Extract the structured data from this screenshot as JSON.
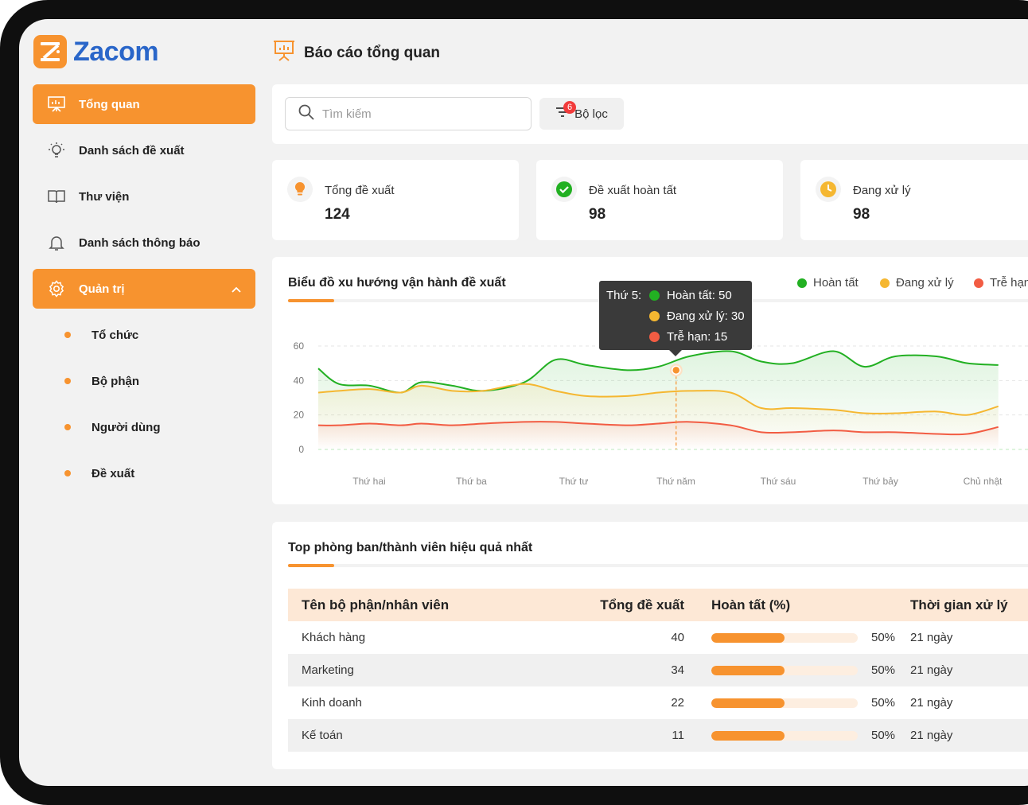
{
  "brand": {
    "name": "Zacom"
  },
  "sidebar": {
    "items": [
      {
        "label": "Tổng quan",
        "icon": "presentation-icon"
      },
      {
        "label": "Danh sách đề xuất",
        "icon": "lightbulb-icon"
      },
      {
        "label": "Thư viện",
        "icon": "book-icon"
      },
      {
        "label": "Danh sách thông báo",
        "icon": "bell-icon"
      }
    ],
    "group": {
      "label": "Quản trị",
      "icon": "gear-icon"
    },
    "sub_items": [
      "Tổ chức",
      "Bộ phận",
      "Người dùng",
      "Đề xuất"
    ]
  },
  "header": {
    "title": "Báo cáo tổng quan"
  },
  "search": {
    "placeholder": "Tìm kiếm"
  },
  "filter": {
    "label": "Bộ lọc",
    "count": "6"
  },
  "stats": [
    {
      "label": "Tổng đề xuất",
      "value": "124",
      "icon": "lightbulb-icon"
    },
    {
      "label": "Đề xuất hoàn tất",
      "value": "98",
      "icon": "check-circle-icon"
    },
    {
      "label": "Đang xử lý",
      "value": "98",
      "icon": "clock-icon"
    }
  ],
  "colors": {
    "accent": "#f7932f",
    "done": "#22b022",
    "processing": "#f5b731",
    "late": "#f25c43"
  },
  "chart_data": {
    "type": "line",
    "title": "Biểu đồ xu hướng vận hành đề xuất",
    "categories": [
      "Thứ hai",
      "Thứ ba",
      "Thứ tư",
      "Thứ năm",
      "Thứ sáu",
      "Thứ bảy",
      "Chủ nhật"
    ],
    "yticks": [
      0,
      20,
      40,
      60
    ],
    "ylim": [
      0,
      60
    ],
    "x": [
      0,
      0.2,
      0.5,
      0.8,
      1.0,
      1.3,
      1.6,
      2.0,
      2.3,
      2.6,
      3.0,
      3.3,
      3.6,
      4.0,
      4.3,
      4.6,
      5.0,
      5.3,
      5.6,
      6.0,
      6.3,
      6.6
    ],
    "series": [
      {
        "name": "Hoàn tất",
        "values": [
          47,
          38,
          37,
          33,
          39,
          37,
          34,
          39,
          52,
          49,
          46,
          48,
          54,
          57,
          51,
          50,
          57,
          48,
          54,
          54,
          50,
          49
        ]
      },
      {
        "name": "Đang xử lý",
        "values": [
          33,
          34,
          35,
          33,
          37,
          34,
          34,
          38,
          34,
          31,
          31,
          33,
          34,
          33,
          24,
          24,
          23,
          21,
          21,
          22,
          20,
          25
        ]
      },
      {
        "name": "Trễ hạn",
        "values": [
          14,
          14,
          15,
          14,
          15,
          14,
          15,
          16,
          16,
          15,
          14,
          15,
          16,
          14,
          10,
          10,
          11,
          10,
          10,
          9,
          9,
          13
        ]
      }
    ],
    "grid": true,
    "legend_position": "top-right",
    "highlight": {
      "category": "Thứ năm",
      "day_label": "Thứ 5:",
      "lines": [
        "Hoàn tất: 50",
        "Đang xử lý: 30",
        "Trễ hạn: 15"
      ]
    }
  },
  "table": {
    "title": "Top phòng ban/thành viên hiệu quả nhất",
    "headers": [
      "Tên bộ phận/nhân viên",
      "Tổng đề xuất",
      "Hoàn tất (%)",
      "Thời gian xử lý"
    ],
    "rows": [
      {
        "name": "Khách hàng",
        "total": "40",
        "pct": "50%",
        "pct_value": 0.5,
        "time": "21 ngày"
      },
      {
        "name": "Marketing",
        "total": "34",
        "pct": "50%",
        "pct_value": 0.5,
        "time": "21 ngày"
      },
      {
        "name": "Kinh doanh",
        "total": "22",
        "pct": "50%",
        "pct_value": 0.5,
        "time": "21 ngày"
      },
      {
        "name": "Kế toán",
        "total": "11",
        "pct": "50%",
        "pct_value": 0.5,
        "time": "21 ngày"
      }
    ]
  }
}
